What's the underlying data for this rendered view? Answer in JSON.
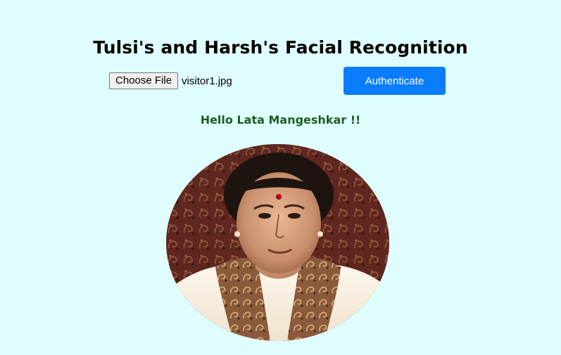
{
  "page": {
    "title": "Tulsi's and Harsh's Facial Recognition"
  },
  "upload": {
    "choose_label": "Choose File",
    "file_name": "visitor1.jpg"
  },
  "actions": {
    "authenticate_label": "Authenticate"
  },
  "result": {
    "greeting": "Hello Lata Mangeshkar !!"
  },
  "colors": {
    "background": "#e0fdfd",
    "accent": "#0a7cff",
    "greeting": "#1b5e20"
  },
  "image": {
    "subject": "portrait-photo",
    "shape": "ellipse"
  }
}
